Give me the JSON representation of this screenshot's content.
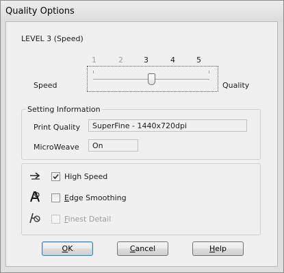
{
  "window": {
    "title": "Quality Options"
  },
  "level": {
    "text": "LEVEL 3 (Speed)"
  },
  "slider": {
    "ticks": [
      "1",
      "2",
      "3",
      "4",
      "5"
    ],
    "value": 3,
    "left_label": "Speed",
    "right_label": "Quality"
  },
  "setting_info": {
    "legend": "Setting Information",
    "print_quality_label": "Print Quality",
    "print_quality_value": "SuperFine - 1440x720dpi",
    "microweave_label": "MicroWeave",
    "microweave_value": "On"
  },
  "options": {
    "high_speed": {
      "label": "High Speed",
      "checked": true,
      "enabled": true,
      "icon": "high-speed-icon"
    },
    "edge_smoothing": {
      "label_prefix": "E",
      "label_rest": "dge Smoothing",
      "checked": false,
      "enabled": true,
      "icon": "edge-smoothing-icon"
    },
    "finest_detail": {
      "label_prefix": "F",
      "label_rest": "inest Detail",
      "checked": false,
      "enabled": false,
      "icon": "finest-detail-icon"
    }
  },
  "buttons": {
    "ok": {
      "prefix": "O",
      "rest": "K"
    },
    "cancel": {
      "prefix": "C",
      "rest": "ancel"
    },
    "help": {
      "prefix": "H",
      "rest": "elp"
    }
  },
  "colors": {
    "dialog_bg": "#f0f0f0",
    "default_button_border": "#3c7fb1"
  }
}
